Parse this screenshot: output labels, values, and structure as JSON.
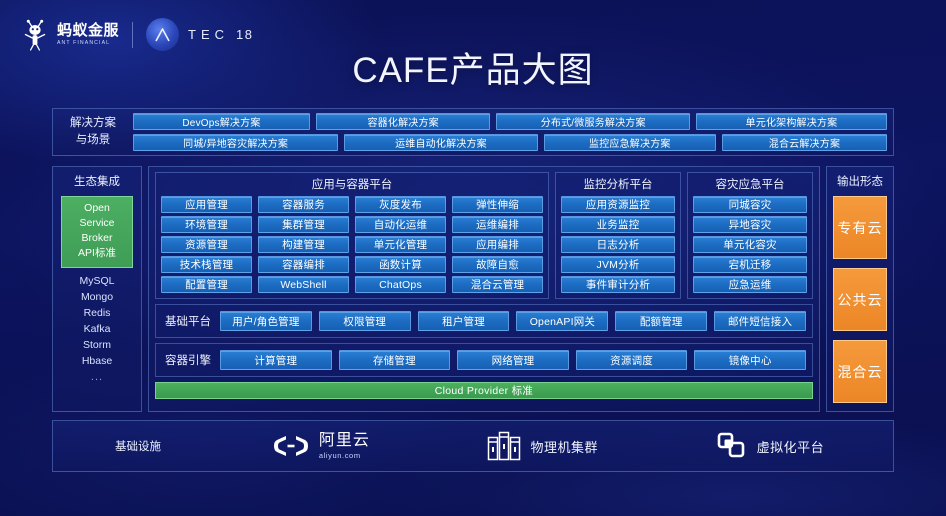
{
  "brand": {
    "ant_cn": "蚂蚁金服",
    "ant_en": "ANT FINANCIAL",
    "atec_letters": "TEC",
    "atec_num": "18"
  },
  "title": "CAFE产品大图",
  "solutions": {
    "label": "解决方案\n与场景",
    "row1": [
      "DevOps解决方案",
      "容器化解决方案",
      "分布式/微服务解决方案",
      "单元化架构解决方案"
    ],
    "row2": [
      "同城/异地容灾解决方案",
      "运维自动化解决方案",
      "监控应急解决方案",
      "混合云解决方案"
    ]
  },
  "ecosystem": {
    "title": "生态集成",
    "standard": [
      "Open",
      "Service",
      "Broker",
      "API标准"
    ],
    "items": [
      "MySQL",
      "Mongo",
      "Redis",
      "Kafka",
      "Storm",
      "Hbase",
      "..."
    ]
  },
  "app_container_platform": {
    "title": "应用与容器平台",
    "cells": [
      "应用管理",
      "容器服务",
      "灰度发布",
      "弹性伸缩",
      "环境管理",
      "集群管理",
      "自动化运维",
      "运维编排",
      "资源管理",
      "构建管理",
      "单元化管理",
      "应用编排",
      "技术栈管理",
      "容器编排",
      "函数计算",
      "故障自愈",
      "配置管理",
      "WebShell",
      "ChatOps",
      "混合云管理"
    ]
  },
  "monitor_platform": {
    "title": "监控分析平台",
    "cells": [
      "应用资源监控",
      "业务监控",
      "日志分析",
      "JVM分析",
      "事件审计分析"
    ]
  },
  "dr_platform": {
    "title": "容灾应急平台",
    "cells": [
      "同城容灾",
      "异地容灾",
      "单元化容灾",
      "宕机迁移",
      "应急运维"
    ]
  },
  "basic_platform": {
    "label": "基础平台",
    "cells": [
      "用户/角色管理",
      "权限管理",
      "租户管理",
      "OpenAPI网关",
      "配额管理",
      "邮件短信接入"
    ]
  },
  "container_engine": {
    "label": "容器引擎",
    "cells": [
      "计算管理",
      "存储管理",
      "网络管理",
      "资源调度",
      "镜像中心"
    ]
  },
  "cloud_provider_bar": "Cloud Provider 标准",
  "output_forms": {
    "title": "输出形态",
    "items": [
      "专有云",
      "公共云",
      "混合云"
    ]
  },
  "infrastructure": {
    "label": "基础设施",
    "items": [
      {
        "icon": "aliyun-logo-icon",
        "cn": "阿里云",
        "en": "aliyun.com"
      },
      {
        "icon": "server-rack-icon",
        "label": "物理机集群"
      },
      {
        "icon": "virtualization-icon",
        "label": "虚拟化平台"
      }
    ]
  },
  "colors": {
    "background": "#0d1460",
    "cell_blue": "#1d6ec4",
    "accent_green": "#4caf62",
    "accent_orange": "#ec8626",
    "panel_border": "#78a0eb"
  }
}
